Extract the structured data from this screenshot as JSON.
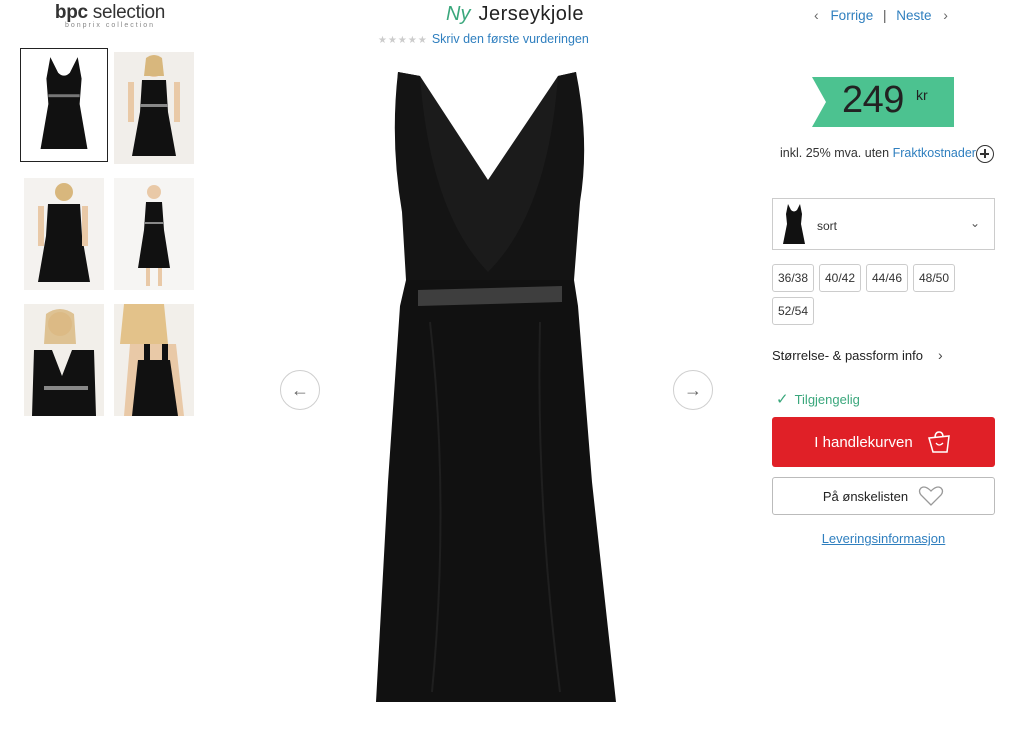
{
  "brand": {
    "name_bold": "bpc",
    "name_rest": " selection",
    "tagline": "bonprix collection"
  },
  "product": {
    "new_label": "Ny",
    "title": "Jerseykjole",
    "rating_stars": "★★★★★",
    "rating_link": "Skriv den første vurderingen"
  },
  "pager": {
    "prev": "Forrige",
    "separator": "|",
    "next": "Neste"
  },
  "price": {
    "value": "249",
    "currency": "kr",
    "badge_color": "#4cc290"
  },
  "vat": {
    "text": "inkl. 25% mva. uten ",
    "link": "Fraktkostnader"
  },
  "color_select": {
    "selected": "sort"
  },
  "sizes": [
    "36/38",
    "40/42",
    "44/46",
    "48/50",
    "52/54"
  ],
  "fit_info": "Størrelse- & passform info",
  "availability": "Tilgjengelig",
  "cart_button": {
    "label": "I handlekurven",
    "color": "#e02027"
  },
  "wishlist_button": {
    "label": "På ønskelisten"
  },
  "delivery_link": "Leveringsinformasjon",
  "icons": [
    "chevron-left-icon",
    "chevron-right-icon",
    "plus-circle-icon",
    "chevron-down-icon",
    "check-icon",
    "shopping-bag-icon",
    "heart-icon",
    "arrow-left-icon",
    "arrow-right-icon"
  ]
}
